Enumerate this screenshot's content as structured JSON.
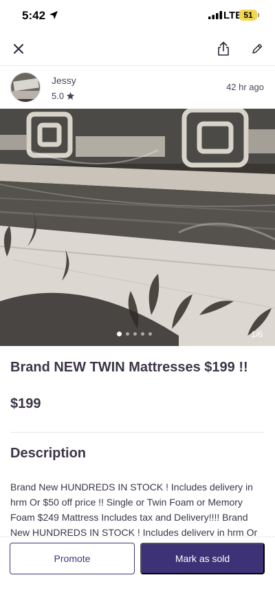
{
  "status_bar": {
    "time": "5:42",
    "network": "LTE",
    "battery": "51"
  },
  "nav": {
    "close_icon": "close-icon",
    "share_icon": "share-icon",
    "edit_icon": "edit-icon"
  },
  "seller": {
    "name": "Jessy",
    "rating": "5.0",
    "posted": "42 hr  ago"
  },
  "photo": {
    "counter": "1/6",
    "dots": 5,
    "active_dot": 0
  },
  "listing": {
    "title": "Brand NEW TWIN Mattresses $199 !!",
    "price": "$199",
    "description_heading": "Description",
    "description": "Brand New HUNDREDS IN STOCK ! Includes delivery in hrm Or $50 off price !! Single or Twin Foam or Memory Foam $249 Mattress Includes tax and Delivery!!!! Brand New HUNDREDS IN STOCK ! Includes delivery in hrm Or"
  },
  "actions": {
    "promote": "Promote",
    "mark_sold": "Mark as sold"
  },
  "colors": {
    "primary": "#3d3276",
    "battery": "#f3d64b",
    "text": "#3d3547"
  }
}
